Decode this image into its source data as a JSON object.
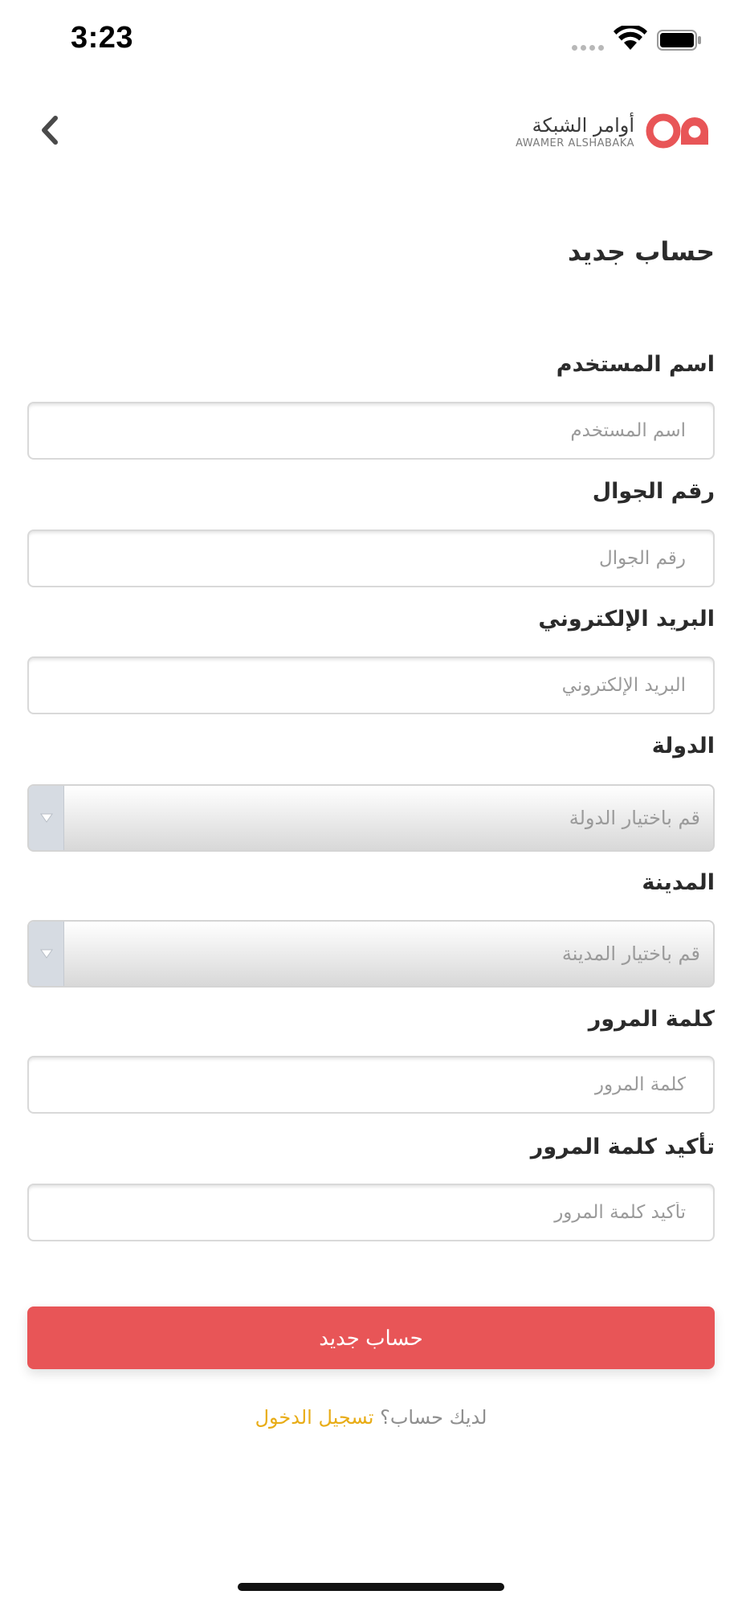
{
  "status_bar": {
    "time": "3:23"
  },
  "header": {
    "logo_ar": "أوامر الشبكة",
    "logo_en": "AWAMER ALSHABAKA",
    "brand_color": "#e85557"
  },
  "form": {
    "title": "حساب جديد",
    "fields": [
      {
        "label": "اسم المستخدم",
        "placeholder": "اسم المستخدم",
        "type": "text"
      },
      {
        "label": "رقم الجوال",
        "placeholder": "رقم الجوال",
        "type": "text"
      },
      {
        "label": "البريد الإلكتروني",
        "placeholder": "البريد الإلكتروني",
        "type": "text"
      },
      {
        "label": "الدولة",
        "placeholder": "قم باختيار الدولة",
        "type": "select"
      },
      {
        "label": "المدينة",
        "placeholder": "قم باختيار المدينة",
        "type": "select"
      },
      {
        "label": "كلمة المرور",
        "placeholder": "كلمة المرور",
        "type": "password"
      },
      {
        "label": "تأكيد كلمة المرور",
        "placeholder": "تأكيد كلمة المرور",
        "type": "password"
      }
    ],
    "submit_label": "حساب جديد"
  },
  "footer": {
    "question": "لديك حساب؟",
    "login_link": "تسجيل الدخول",
    "link_color": "#e8ac16"
  },
  "icons": {
    "back": "chevron-left-icon",
    "select_arrow": "triangle-down-icon"
  }
}
